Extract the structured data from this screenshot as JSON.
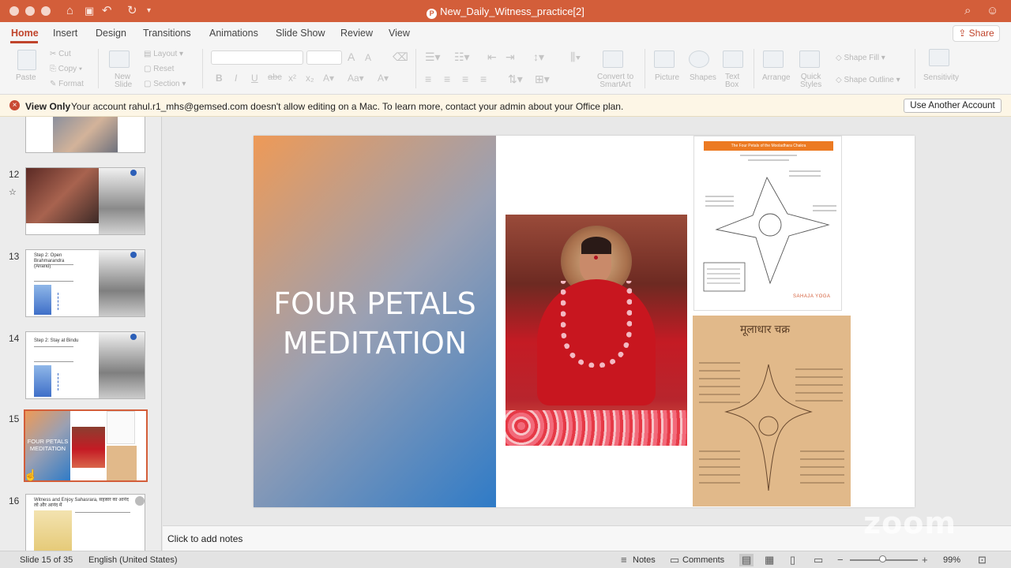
{
  "window": {
    "title": "New_Daily_Witness_practice[2]",
    "app_badge": "P"
  },
  "tabs": [
    "Home",
    "Insert",
    "Design",
    "Transitions",
    "Animations",
    "Slide Show",
    "Review",
    "View"
  ],
  "active_tab": "Home",
  "share_label": "Share",
  "ribbon": {
    "paste": "Paste",
    "cut": "Cut",
    "copy": "Copy",
    "format": "Format",
    "new_slide": "New\nSlide",
    "layout": "Layout",
    "reset": "Reset",
    "section": "Section",
    "convert": "Convert to\nSmartArt",
    "picture": "Picture",
    "shapes": "Shapes",
    "text_box": "Text\nBox",
    "arrange": "Arrange",
    "quick_styles": "Quick\nStyles",
    "shape_fill": "Shape Fill",
    "shape_outline": "Shape Outline",
    "sensitivity": "Sensitivity"
  },
  "infobar": {
    "label": "View Only",
    "message": "Your account rahul.r1_mhs@gemsed.com doesn't allow editing on a Mac. To learn more, contact your admin about your Office plan.",
    "button": "Use Another Account"
  },
  "thumbnails": [
    {
      "number": "12",
      "star": true
    },
    {
      "number": "13",
      "text": "Step 2: Open Brahmarandra (Anand)"
    },
    {
      "number": "14",
      "text": "Step 2: Stay at Bindu"
    },
    {
      "number": "15",
      "text": "FOUR PETALS MEDITATION",
      "selected": true
    },
    {
      "number": "16",
      "text": "Witness and Enjoy Sahasrara, सहस्रार का आनंद लो और आनंद में"
    }
  ],
  "slide": {
    "title_line1": "FOUR PETALS",
    "title_line2": "MEDITATION",
    "diagram_header": "The Four Petals of the Mooladhara Chakra",
    "diagram_logo": "SAHAJA YOGA",
    "scan_title": "मूलाधार चक्र"
  },
  "notes_placeholder": "Click to add notes",
  "watermark": "zoom",
  "status": {
    "slide_info": "Slide 15 of 35",
    "language": "English (United States)",
    "notes": "Notes",
    "comments": "Comments",
    "zoom_level": "99%"
  },
  "colors": {
    "accent": "#d35e3a",
    "active_tab": "#c0442b",
    "infobar_bg": "#fdf6e6"
  }
}
